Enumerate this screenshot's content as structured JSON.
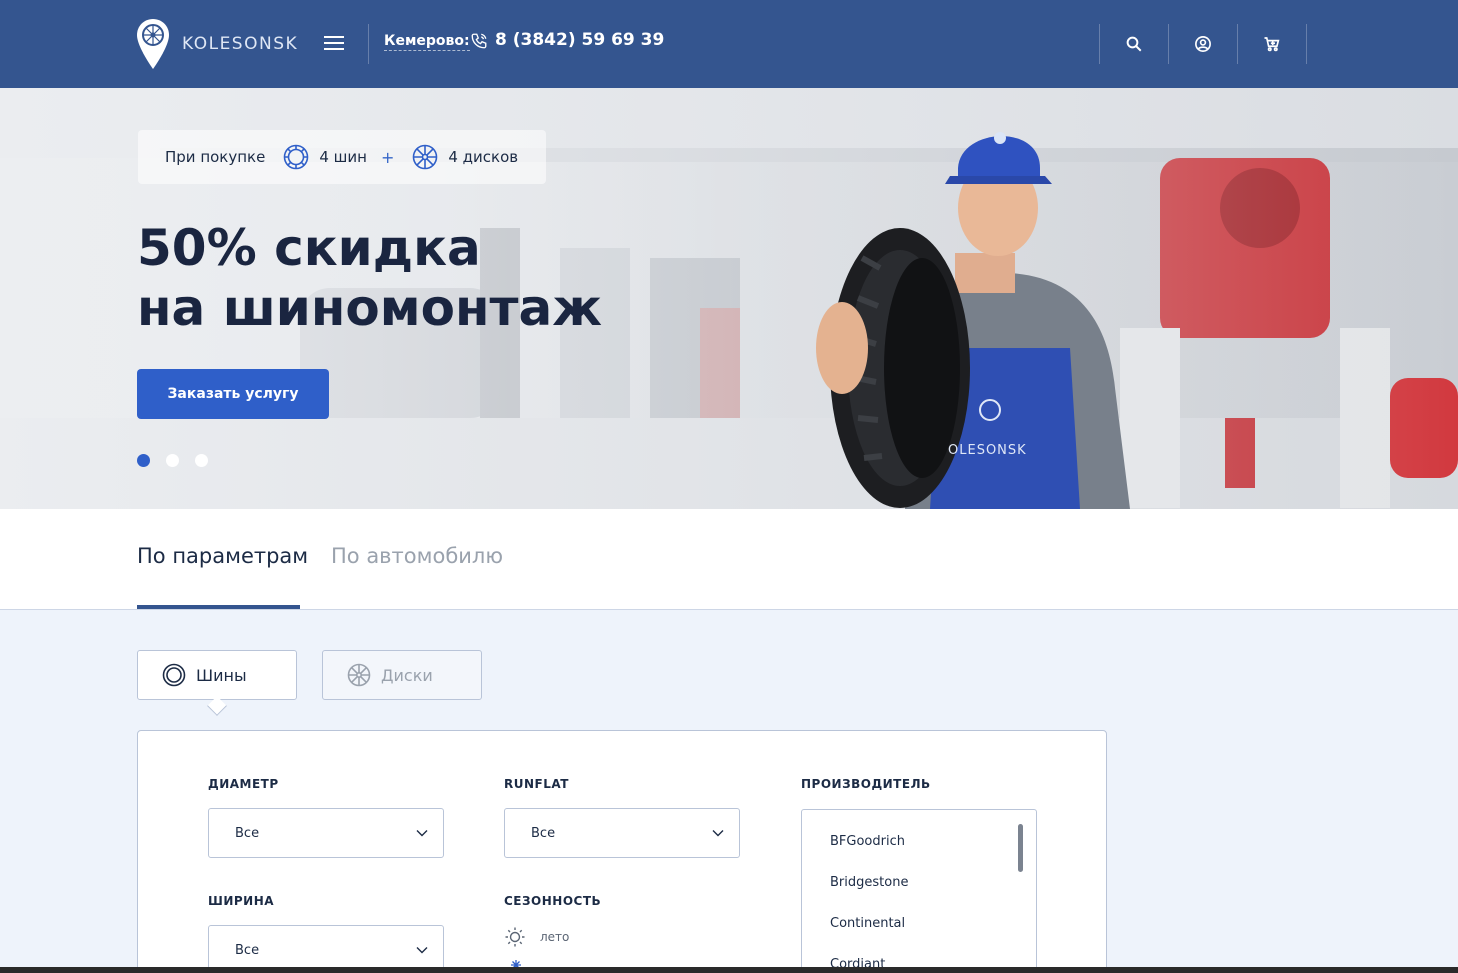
{
  "header": {
    "logo_text": "KOLESONSK",
    "city_label": "Кемерово:",
    "phone": "8 (3842) 59 69 39",
    "icons": [
      "menu-icon",
      "phone-icon",
      "search-icon",
      "user-icon",
      "cart-icon"
    ]
  },
  "hero": {
    "promo": {
      "prefix": "При покупке",
      "tires": "4 шин",
      "plus": "+",
      "rims": "4 дисков"
    },
    "title_line1": "50% скидка",
    "title_line2": "на шиномонтаж",
    "cta_label": "Заказать услугу",
    "slides_total": 3,
    "slide_active": 1
  },
  "search_tabs": {
    "by_params": "По параметрам",
    "by_car": "По автомобилю"
  },
  "product_tabs": {
    "tires": "Шины",
    "rims": "Диски"
  },
  "filters": {
    "diameter": {
      "label": "ДИАМЕТР",
      "value": "Все"
    },
    "runflat": {
      "label": "RUNFLAT",
      "value": "Все"
    },
    "manufacturer": {
      "label": "ПРОИЗВОДИТЕЛЬ",
      "items": [
        "BFGoodrich",
        "Bridgestone",
        "Continental",
        "Cordiant"
      ]
    },
    "width": {
      "label": "ШИРИНА",
      "value": "Все"
    },
    "season": {
      "label": "СЕЗОННОСТЬ",
      "summer": "лето"
    }
  },
  "colors": {
    "header_bg": "#34558f",
    "accent": "#2f5fc9",
    "text_dark": "#1c2b45",
    "page_bg": "#eef3fb"
  }
}
